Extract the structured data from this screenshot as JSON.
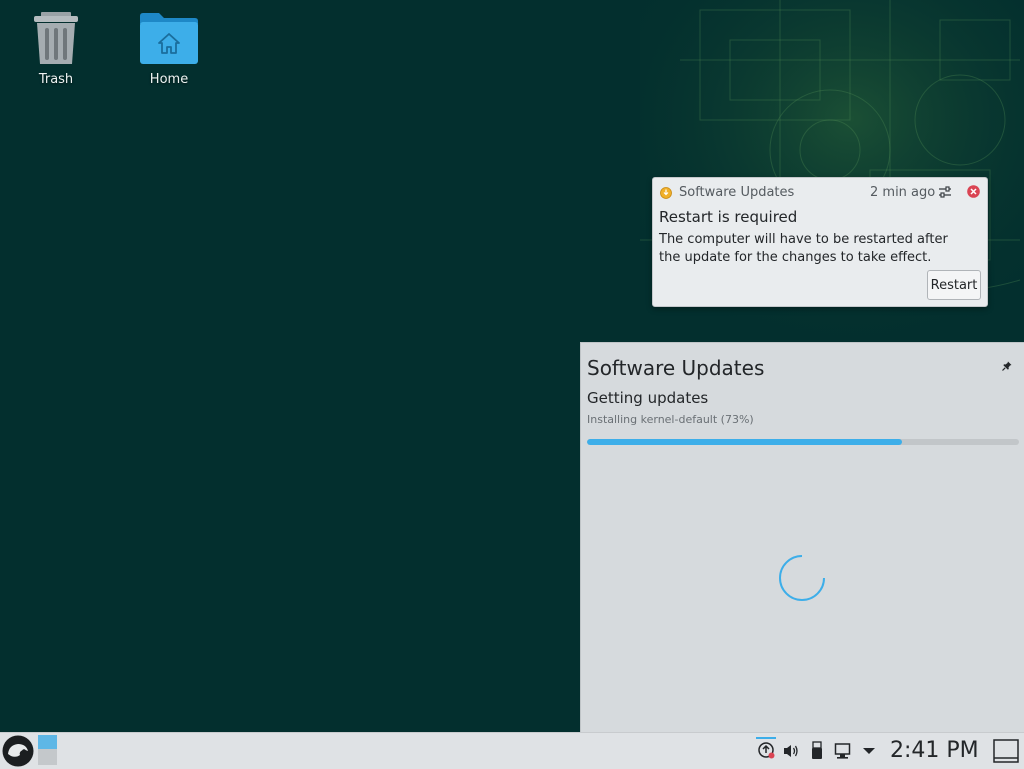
{
  "desktop": {
    "icons": [
      {
        "label": "Trash"
      },
      {
        "label": "Home"
      }
    ]
  },
  "notification": {
    "app_name": "Software Updates",
    "time": "2 min ago",
    "title": "Restart is required",
    "body": "The computer will have to be restarted after the update for the changes to take effect.",
    "action_label": "Restart"
  },
  "updates_panel": {
    "title": "Software Updates",
    "status": "Getting updates",
    "detail": "Installing kernel-default (73%)",
    "progress": 0.73
  },
  "taskbar": {
    "clock": "2:41 PM"
  },
  "colors": {
    "desktop_background": "#032f2e",
    "accent": "#3daee9",
    "close_red": "#da4453"
  }
}
